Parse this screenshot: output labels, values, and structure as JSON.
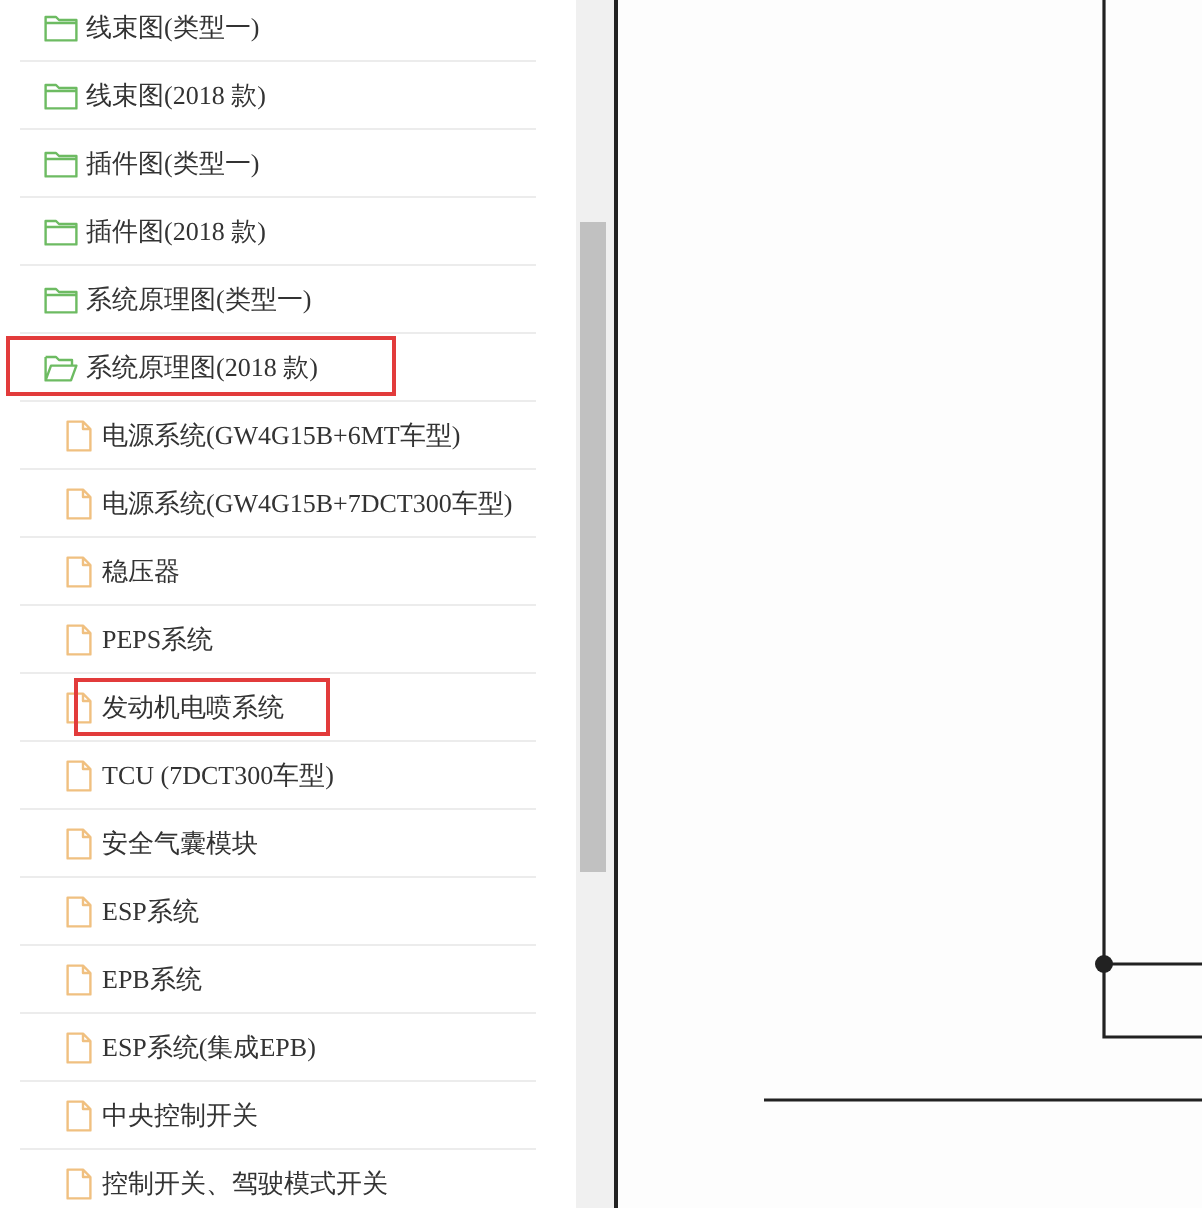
{
  "tree": {
    "items": [
      {
        "kind": "folder",
        "label": "线束图(类型一)",
        "expanded": false,
        "highlighted": false
      },
      {
        "kind": "folder",
        "label": "线束图(2018 款)",
        "expanded": false,
        "highlighted": false
      },
      {
        "kind": "folder",
        "label": "插件图(类型一)",
        "expanded": false,
        "highlighted": false
      },
      {
        "kind": "folder",
        "label": "插件图(2018 款)",
        "expanded": false,
        "highlighted": false
      },
      {
        "kind": "folder",
        "label": "系统原理图(类型一)",
        "expanded": false,
        "highlighted": false
      },
      {
        "kind": "folder",
        "label": "系统原理图(2018 款)",
        "expanded": true,
        "highlighted": true,
        "children": [
          {
            "kind": "file",
            "label": "电源系统(GW4G15B+6MT车型)",
            "highlighted": false
          },
          {
            "kind": "file",
            "label": "电源系统(GW4G15B+7DCT300车型)",
            "highlighted": false
          },
          {
            "kind": "file",
            "label": "稳压器",
            "highlighted": false
          },
          {
            "kind": "file",
            "label": "PEPS系统",
            "highlighted": false
          },
          {
            "kind": "file",
            "label": "发动机电喷系统",
            "highlighted": true
          },
          {
            "kind": "file",
            "label": "TCU (7DCT300车型)",
            "highlighted": false
          },
          {
            "kind": "file",
            "label": "安全气囊模块",
            "highlighted": false
          },
          {
            "kind": "file",
            "label": "ESP系统",
            "highlighted": false
          },
          {
            "kind": "file",
            "label": "EPB系统",
            "highlighted": false
          },
          {
            "kind": "file",
            "label": "ESP系统(集成EPB)",
            "highlighted": false
          },
          {
            "kind": "file",
            "label": "中央控制开关",
            "highlighted": false
          },
          {
            "kind": "file",
            "label": "控制开关、驾驶模式开关",
            "highlighted": false
          }
        ]
      }
    ]
  }
}
